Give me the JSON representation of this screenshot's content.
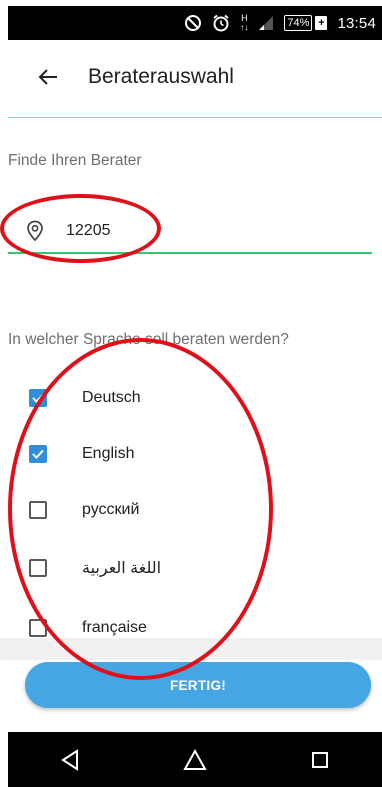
{
  "status_bar": {
    "icons": [
      "do-not-disturb-icon",
      "alarm-clock-icon",
      "hspa-data-icon",
      "signal-icon"
    ],
    "hspa_label": "H",
    "battery_percent": "74%",
    "battery_charging_symbol": "+",
    "time": "13:54"
  },
  "toolbar": {
    "back_icon": "arrow-left-icon",
    "title": "Beraterauswahl"
  },
  "search": {
    "label": "Finde Ihren Berater",
    "location_icon": "location-pin-icon",
    "zip_value": "12205"
  },
  "language_section": {
    "question": "In welcher Sprache soll beraten werden?",
    "languages": [
      {
        "label": "Deutsch",
        "checked": true
      },
      {
        "label": "English",
        "checked": true
      },
      {
        "label": "русский",
        "checked": false
      },
      {
        "label": "اللغة العربية",
        "checked": false
      },
      {
        "label": "française",
        "checked": false
      }
    ]
  },
  "actions": {
    "done_label": "FERTIG!"
  },
  "nav_bar": {
    "icons": [
      "back-triangle-icon",
      "home-icon",
      "recents-icon"
    ]
  },
  "colors": {
    "accent_blue": "#45a6e3",
    "checkbox_blue": "#2f8fd9",
    "input_underline_green": "#36c76c",
    "toolbar_divider": "#80dbe0",
    "annotation_red": "#e0101a"
  }
}
